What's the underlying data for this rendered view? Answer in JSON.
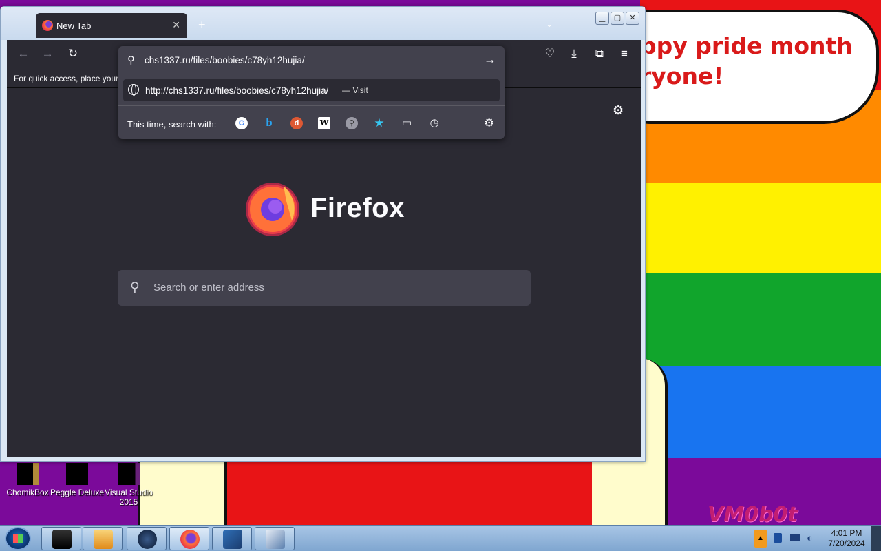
{
  "wallpaper": {
    "bubble_lines": [
      "ppy pride month",
      "ryone!"
    ],
    "watermark": "VM0b0t"
  },
  "desktop_icons": [
    {
      "label": "ChomikBox"
    },
    {
      "label": "Peggle Deluxe"
    },
    {
      "label": "Visual Studio 2015"
    }
  ],
  "browser": {
    "tab": {
      "title": "New Tab"
    },
    "new_tab_glyph": "+",
    "bookmarks_hint": "For quick access, place your bookmarks here on the bookmarks toolbar.",
    "url_input": "chs1337.ru/files/boobies/c78yh12hujia/",
    "suggestion": {
      "url": "http://chs1337.ru/files/boobies/c78yh12hujia/",
      "action": "— Visit"
    },
    "oneoff_label": "This time, search with:",
    "brand": "Firefox",
    "search_placeholder": "Search or enter address"
  },
  "taskbar": {
    "clock_time": "4:01 PM",
    "clock_date": "7/20/2024"
  }
}
